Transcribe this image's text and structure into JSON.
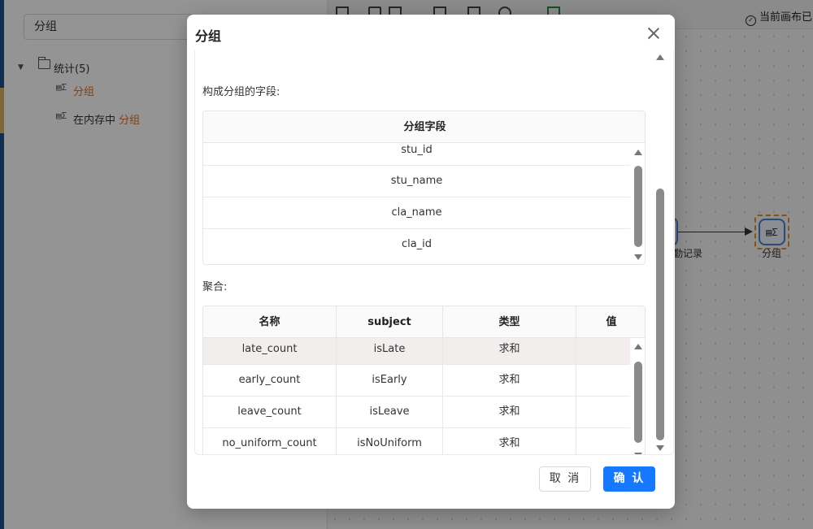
{
  "left_panel": {
    "search_value": "分组",
    "tree": {
      "root_label": "统计(5)",
      "items": [
        {
          "icon": "group-sum-icon",
          "label": "分组"
        },
        {
          "icon": "group-memory-icon",
          "prefix": "在内存中",
          "highlight": "分组"
        }
      ]
    }
  },
  "canvas": {
    "status_text": "当前画布已",
    "node_left_label": "勤记录",
    "node_right_label": "分组"
  },
  "dialog": {
    "title": "分组",
    "group_fields": {
      "label": "构成分组的字段:",
      "header": "分组字段",
      "rows": [
        "stu_id",
        "stu_name",
        "cla_name",
        "cla_id"
      ]
    },
    "aggregation": {
      "label": "聚合:",
      "columns": [
        "名称",
        "subject",
        "类型",
        "值"
      ],
      "rows": [
        [
          "late_count",
          "isLate",
          "求和",
          ""
        ],
        [
          "early_count",
          "isEarly",
          "求和",
          ""
        ],
        [
          "leave_count",
          "isLeave",
          "求和",
          ""
        ],
        [
          "no_uniform_count",
          "isNoUniform",
          "求和",
          ""
        ]
      ]
    },
    "cancel_label": "取 消",
    "ok_label": "确 认"
  }
}
